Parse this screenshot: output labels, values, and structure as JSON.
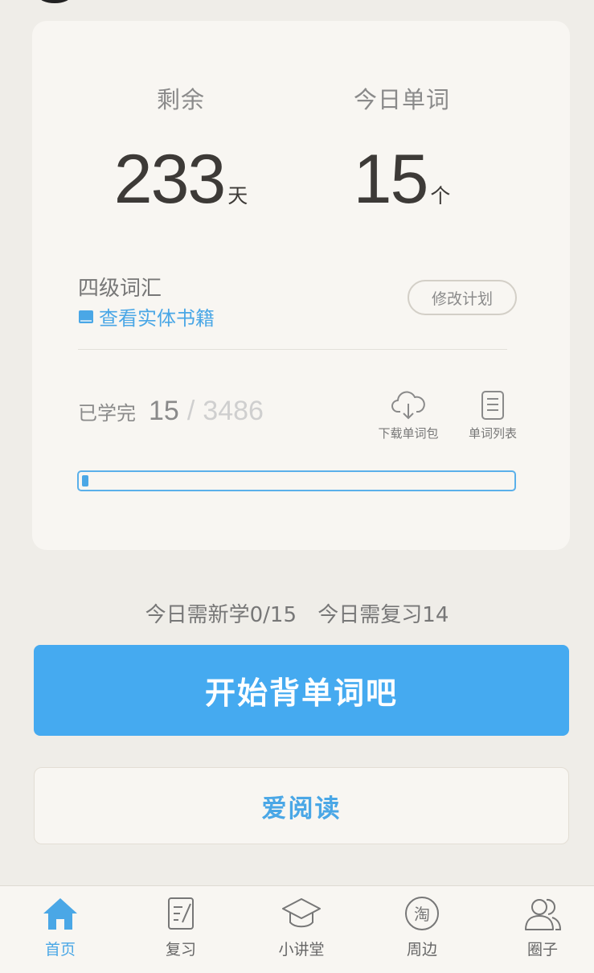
{
  "plan": {
    "remaining_label": "剩余",
    "remaining_value": "233",
    "remaining_unit": "天",
    "today_words_label": "今日单词",
    "today_words_value": "15",
    "today_words_unit": "个"
  },
  "book": {
    "title": "四级词汇",
    "view_physical_label": "查看实体书籍",
    "modify_plan_label": "修改计划"
  },
  "progress": {
    "learned_label": "已学完",
    "learned_count": "15",
    "separator": "/",
    "total_count": "3486",
    "fraction": 0.0043,
    "download_label": "下载单词包",
    "word_list_label": "单词列表"
  },
  "today": {
    "new_label": "今日需新学0/15",
    "review_label": "今日需复习14"
  },
  "actions": {
    "start_label": "开始背单词吧",
    "read_label": "爱阅读"
  },
  "tabs": [
    {
      "label": "首页",
      "icon": "home-icon",
      "active": true
    },
    {
      "label": "复习",
      "icon": "review-icon",
      "active": false
    },
    {
      "label": "小讲堂",
      "icon": "graduation-cap-icon",
      "active": false
    },
    {
      "label": "周边",
      "icon": "taobao-icon",
      "active": false
    },
    {
      "label": "圈子",
      "icon": "people-icon",
      "active": false
    }
  ],
  "colors": {
    "accent": "#45aaf0",
    "link": "#4aa7e6",
    "background": "#efede8",
    "card": "#f8f6f2"
  }
}
